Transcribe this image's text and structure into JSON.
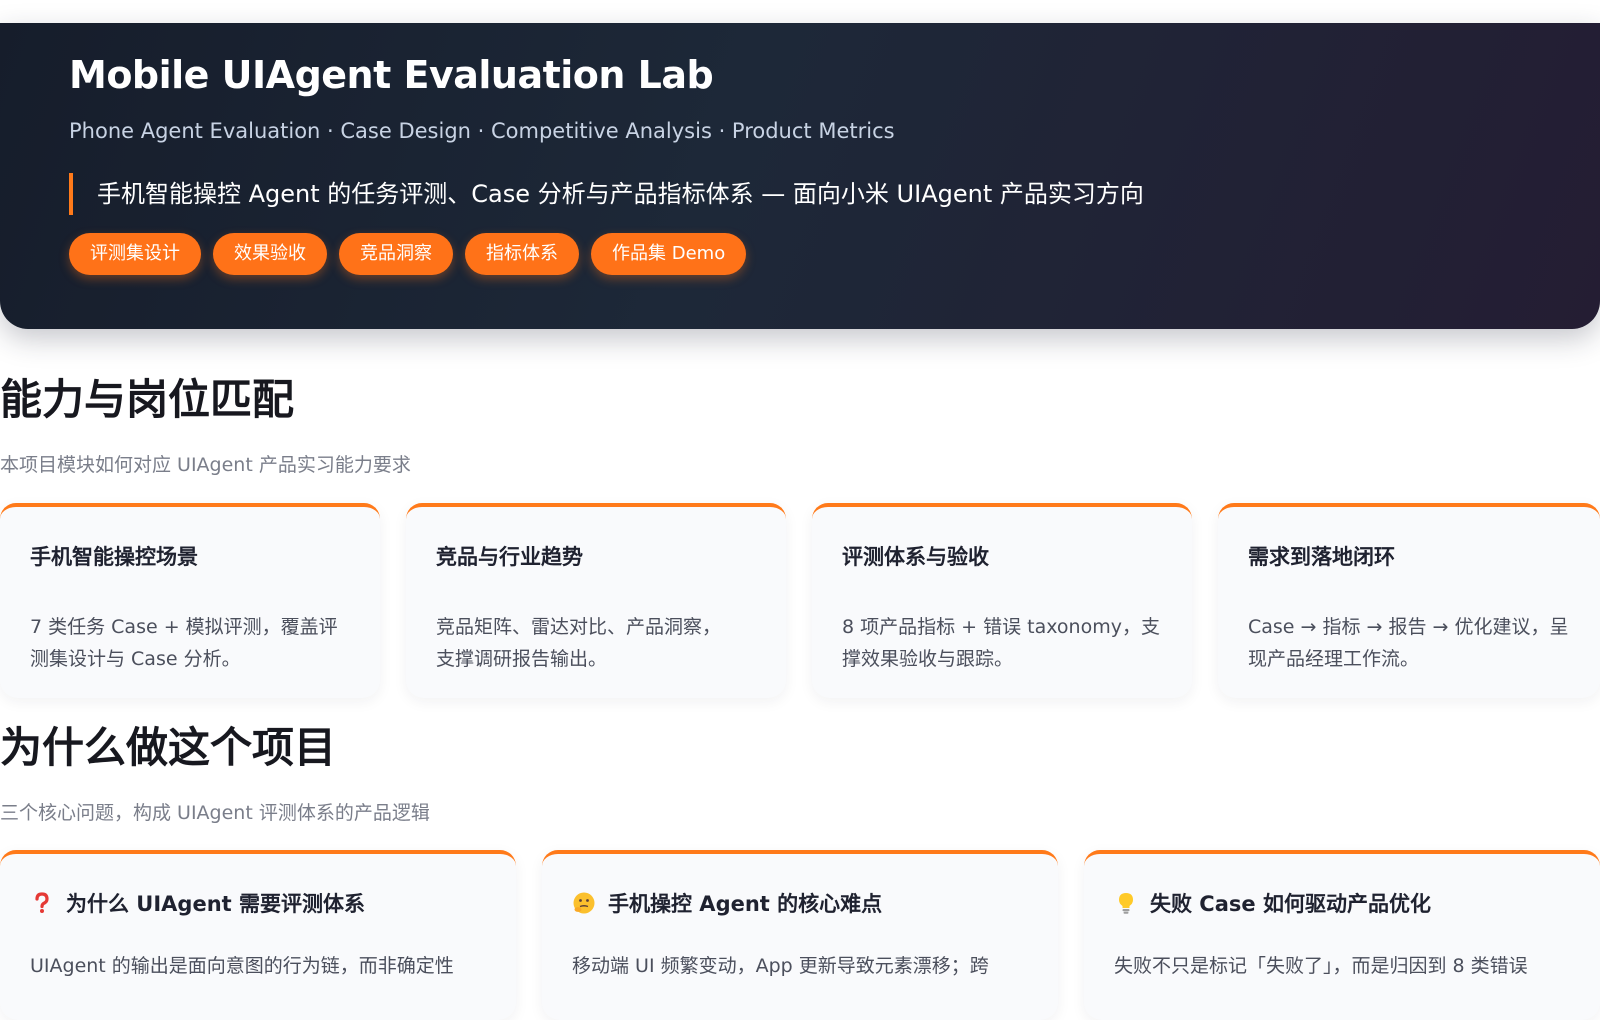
{
  "hero": {
    "title": "Mobile UIAgent Evaluation Lab",
    "subtitle": "Phone Agent Evaluation · Case Design · Competitive Analysis · Product Metrics",
    "tagline": "手机智能操控 Agent 的任务评测、Case 分析与产品指标体系 — 面向小米 UIAgent 产品实习方向",
    "tags": [
      "评测集设计",
      "效果验收",
      "竞品洞察",
      "指标体系",
      "作品集 Demo"
    ]
  },
  "capability": {
    "title": "能力与岗位匹配",
    "subtitle": "本项目模块如何对应 UIAgent 产品实习能力要求",
    "cards": [
      {
        "title": "手机智能操控场景",
        "line1": "7 类任务 Case + 模拟评测，覆盖评",
        "line2": "测集设计与 Case 分析。"
      },
      {
        "title": "竞品与行业趋势",
        "line1": "竞品矩阵、雷达对比、产品洞察，",
        "line2": "支撑调研报告输出。"
      },
      {
        "title": "评测体系与验收",
        "line1": "8 项产品指标 + 错误 taxonomy，支",
        "line2": "撑效果验收与跟踪。"
      },
      {
        "title": "需求到落地闭环",
        "line1": "Case → 指标 → 报告 → 优化建议，呈",
        "line2": "现产品经理工作流。"
      }
    ]
  },
  "why": {
    "title": "为什么做这个项目",
    "subtitle": "三个核心问题，构成 UIAgent 评测体系的产品逻辑",
    "cards": [
      {
        "icon": "question-mark-icon",
        "title": "为什么 UIAgent 需要评测体系",
        "body": "UIAgent 的输出是面向意图的行为链，而非确定性"
      },
      {
        "icon": "thinking-face-icon",
        "title": "手机操控 Agent 的核心难点",
        "body": "移动端 UI 频繁变动，App 更新导致元素漂移；跨"
      },
      {
        "icon": "lightbulb-icon",
        "title": "失败 Case 如何驱动产品优化",
        "body": "失败不只是标记「失败了」，而是归因到 8 类错误"
      }
    ]
  },
  "colors": {
    "accent": "#ff7218",
    "hero_bg": "#1a2232"
  }
}
